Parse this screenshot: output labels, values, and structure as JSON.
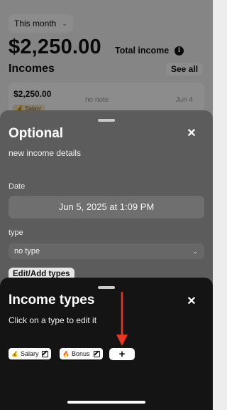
{
  "background": {
    "period": "This month",
    "total_amount": "$2,250.00",
    "total_label": "Total income",
    "incomes_title": "Incomes",
    "see_all_label": "See all",
    "income_item": {
      "amount": "$2,250.00",
      "note": "no note",
      "date": "Jun 4",
      "tag": "💰 Salary"
    }
  },
  "optional_sheet": {
    "title": "Optional",
    "subtitle": "new income details",
    "date_label": "Date",
    "date_value": "Jun 5, 2025 at 1:09 PM",
    "type_label": "type",
    "type_value": "no type",
    "edit_types_label": "Edit/Add types"
  },
  "types_sheet": {
    "title": "Income types",
    "subtitle": "Click on a type to edit it",
    "types": [
      {
        "emoji": "💰",
        "label": "Salary"
      },
      {
        "emoji": "🔥",
        "label": "Bonus"
      }
    ],
    "add_label": "+"
  },
  "icons": {
    "close": "close-icon",
    "info": "info-icon",
    "edit": "edit-icon",
    "chevron": "chevron-down-icon"
  },
  "colors": {
    "annotation_arrow": "#e8361f"
  }
}
